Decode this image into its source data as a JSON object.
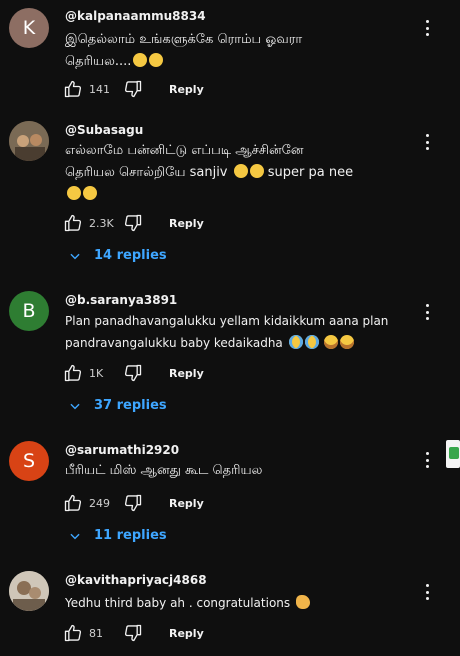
{
  "comments": [
    {
      "handle": "@kalpanaammu8834",
      "avatar_letter": "K",
      "avatar_color": "#8d6e63",
      "text_line1": "இதெல்லாம் உங்களுக்கே ரொம்ப ஓவரா",
      "text_line2": "தெரியல....",
      "likes": "141",
      "reply_label": "Reply"
    },
    {
      "handle": "@Subasagu",
      "avatar_letter": "",
      "text_line1": "எல்லாமே பன்னிட்டு எப்படி ஆச்சின்னே",
      "text_line2": "தெரியல சொல்றியே sanjiv",
      "text_line2_tail": "super pa nee",
      "likes": "2.3K",
      "reply_label": "Reply",
      "replies_label": "14 replies"
    },
    {
      "handle": "@b.saranya3891",
      "avatar_letter": "B",
      "avatar_color": "#2e7d32",
      "text_line1": "Plan panadhavangalukku yellam kidaikkum aana plan",
      "text_line2": "pandravangalukku baby kedaikadha",
      "likes": "1K",
      "reply_label": "Reply",
      "replies_label": "37 replies"
    },
    {
      "handle": "@sarumathi2920",
      "avatar_letter": "S",
      "avatar_color": "#d84315",
      "text_line1": "பீரியட் மிஸ் ஆனது கூட தெரியல",
      "likes": "249",
      "reply_label": "Reply",
      "replies_label": "11 replies"
    },
    {
      "handle": "@kavithapriyacj4868",
      "avatar_letter": "",
      "text_line1": "Yedhu third baby ah . congratulations",
      "likes": "81",
      "reply_label": "Reply"
    }
  ],
  "colors": {
    "background": "#0f0f0f",
    "replies_link": "#3ea6ff"
  }
}
